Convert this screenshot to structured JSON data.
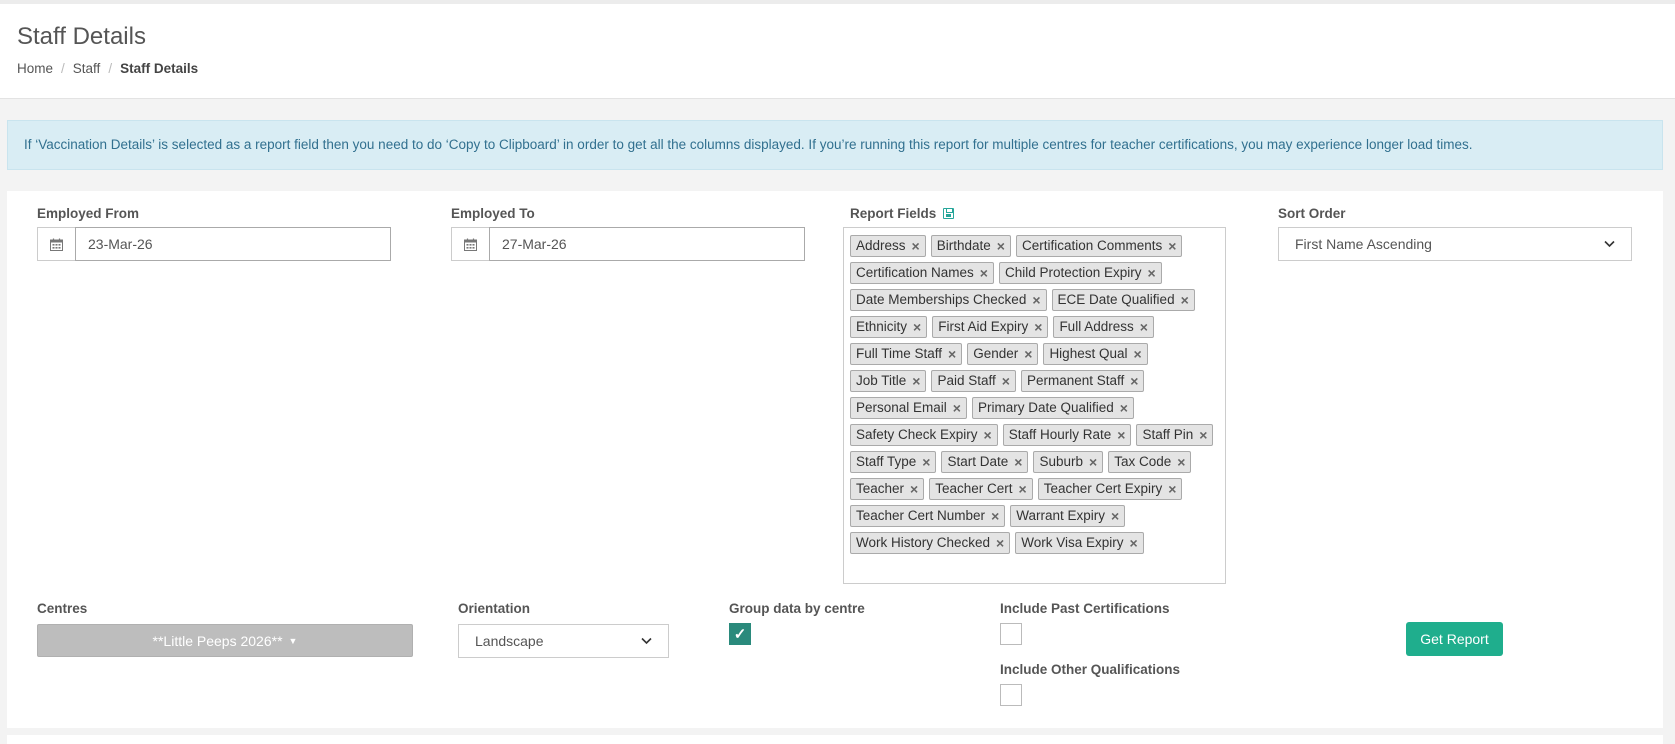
{
  "header": {
    "title": "Staff Details",
    "breadcrumb": {
      "home": "Home",
      "staff": "Staff",
      "current": "Staff Details"
    }
  },
  "alert": {
    "text": "If ‘Vaccination Details’ is selected as a report field then you need to do ‘Copy to Clipboard’ in order to get all the columns displayed. If you’re running this report for multiple centres for teacher certifications, you may experience longer load times."
  },
  "form": {
    "employed_from": {
      "label": "Employed From",
      "value": "23-Mar-26"
    },
    "employed_to": {
      "label": "Employed To",
      "value": "27-Mar-26"
    },
    "report_fields": {
      "label": "Report Fields",
      "tags": [
        [
          "Address",
          "Birthdate",
          "Certification Comments"
        ],
        [
          "Certification Names",
          "Child Protection Expiry"
        ],
        [
          "Date Memberships Checked",
          "ECE Date Qualified"
        ],
        [
          "Ethnicity",
          "First Aid Expiry",
          "Full Address"
        ],
        [
          "Full Time Staff",
          "Gender",
          "Highest Qual"
        ],
        [
          "Job Title",
          "Paid Staff",
          "Permanent Staff"
        ],
        [
          "Personal Email",
          "Primary Date Qualified"
        ],
        [
          "Safety Check Expiry",
          "Staff Hourly Rate",
          "Staff Pin"
        ],
        [
          "Staff Type",
          "Start Date",
          "Suburb",
          "Tax Code"
        ],
        [
          "Teacher",
          "Teacher Cert",
          "Teacher Cert Expiry"
        ],
        [
          "Teacher Cert Number",
          "Warrant Expiry"
        ],
        [
          "Work History Checked",
          "Work Visa Expiry"
        ]
      ],
      "remove_glyph": "×"
    },
    "sort_order": {
      "label": "Sort Order",
      "value": "First Name Ascending"
    },
    "centres": {
      "label": "Centres",
      "value": "**Little Peeps 2026**"
    },
    "orientation": {
      "label": "Orientation",
      "value": "Landscape"
    },
    "group_by_centre": {
      "label": "Group data by centre",
      "checked": true
    },
    "include_past_certs": {
      "label": "Include Past Certifications",
      "checked": false
    },
    "include_other_quals": {
      "label": "Include Other Qualifications",
      "checked": false
    },
    "submit_label": "Get Report"
  },
  "icons": {
    "calendar": "calendar-icon",
    "save": "save-icon",
    "chevron": "chevron-down-icon"
  },
  "colors": {
    "alert_bg": "#d9edf4",
    "alert_text": "#31708f",
    "accent": "#1fae8d",
    "checkbox_checked": "#2a8a7c"
  }
}
